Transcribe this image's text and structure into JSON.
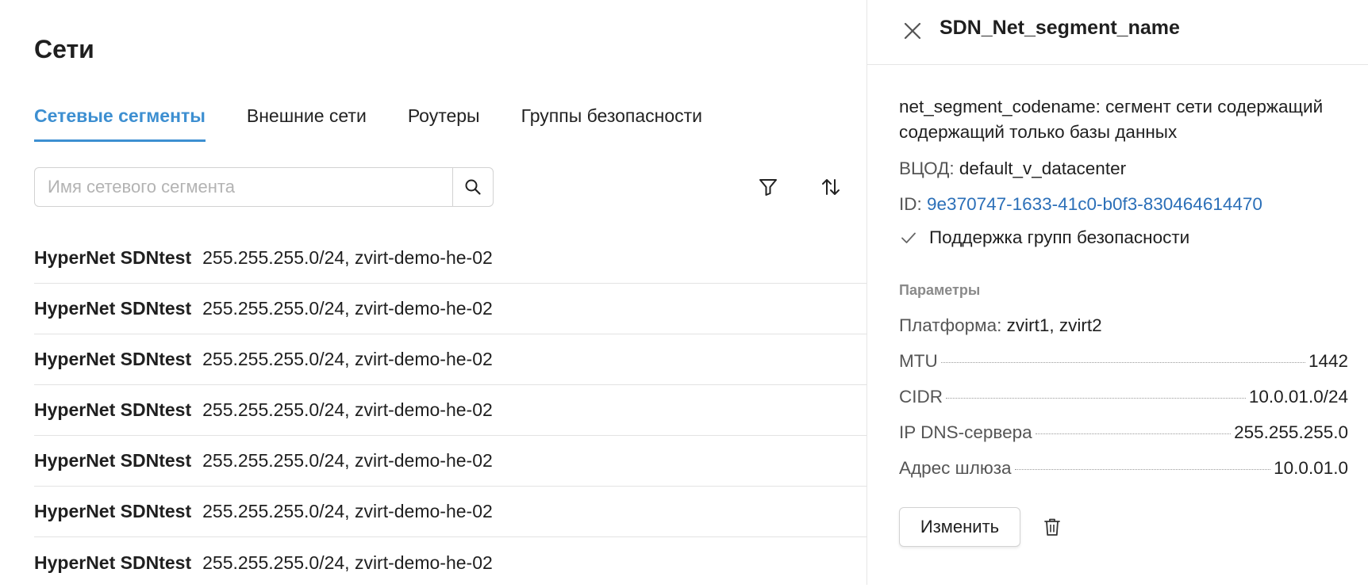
{
  "page": {
    "title": "Сети"
  },
  "tabs": [
    {
      "label": "Сетевые сегменты",
      "active": true
    },
    {
      "label": "Внешние сети",
      "active": false
    },
    {
      "label": "Роутеры",
      "active": false
    },
    {
      "label": "Группы безопасности",
      "active": false
    }
  ],
  "search": {
    "placeholder": "Имя сетевого сегмента",
    "value": "",
    "icon": "search-icon"
  },
  "toolbar": {
    "filter_icon": "filter-icon",
    "sort_icon": "sort-icon"
  },
  "segments": [
    {
      "name": "HyperNet SDNtest",
      "meta": "255.255.255.0/24, zvirt-demo-he-02"
    },
    {
      "name": "HyperNet SDNtest",
      "meta": "255.255.255.0/24, zvirt-demo-he-02"
    },
    {
      "name": "HyperNet SDNtest",
      "meta": "255.255.255.0/24, zvirt-demo-he-02"
    },
    {
      "name": "HyperNet SDNtest",
      "meta": "255.255.255.0/24, zvirt-demo-he-02"
    },
    {
      "name": "HyperNet SDNtest",
      "meta": "255.255.255.0/24, zvirt-demo-he-02"
    },
    {
      "name": "HyperNet SDNtest",
      "meta": "255.255.255.0/24, zvirt-demo-he-02"
    },
    {
      "name": "HyperNet SDNtest",
      "meta": "255.255.255.0/24, zvirt-demo-he-02"
    }
  ],
  "panel": {
    "title": "SDN_Net_segment_name",
    "description": "net_segment_codename: сегмент сети содержащий содержащий только базы данных",
    "vdc_label": "ВЦОД:",
    "vdc_value": "default_v_datacenter",
    "id_label": "ID:",
    "id_value": "9e370747-1633-41c0-b0f3-830464614470",
    "security_groups_support": "Поддержка групп безопасности",
    "params_title": "Параметры",
    "platform_label": "Платформа:",
    "platform_value": "zvirt1, zvirt2",
    "params": [
      {
        "label": "MTU",
        "value": "1442"
      },
      {
        "label": "CIDR",
        "value": "10.0.01.0/24"
      },
      {
        "label": "IP DNS-сервера",
        "value": "255.255.255.0"
      },
      {
        "label": "Адрес шлюза",
        "value": "10.0.01.0"
      }
    ],
    "edit_label": "Изменить"
  },
  "colors": {
    "accent": "#3d8fd1",
    "link": "#2b6fb8",
    "text": "#1f1f1f",
    "muted": "#8a8a8a"
  }
}
